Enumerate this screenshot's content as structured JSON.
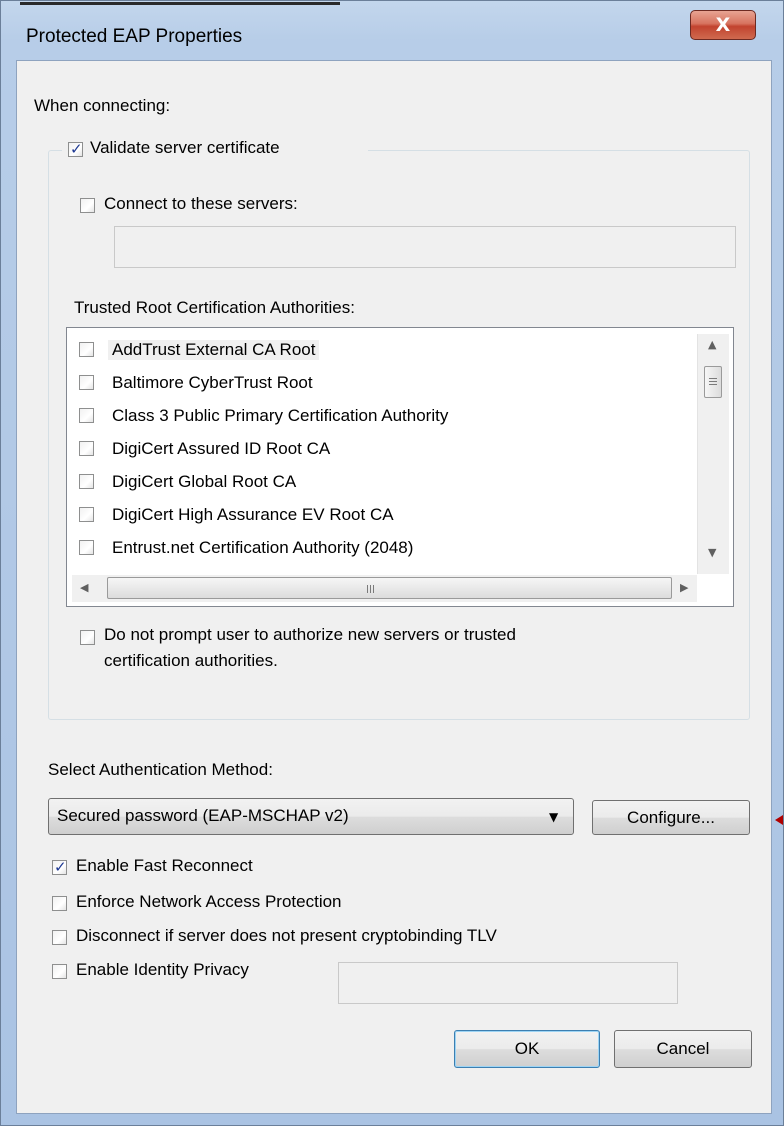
{
  "window": {
    "title": "Protected EAP Properties",
    "close_glyph": "X"
  },
  "connecting": {
    "heading": "When connecting:",
    "validate_label": "Validate server certificate",
    "validate_checked": true,
    "connect_servers_label": "Connect to these servers:",
    "connect_servers_checked": false,
    "servers_value": "",
    "trusted_heading": "Trusted Root Certification Authorities:",
    "ca_list": [
      {
        "label": "AddTrust External CA Root",
        "checked": false
      },
      {
        "label": "Baltimore CyberTrust Root",
        "checked": false
      },
      {
        "label": "Class 3 Public Primary Certification Authority",
        "checked": false
      },
      {
        "label": "DigiCert Assured ID Root CA",
        "checked": false
      },
      {
        "label": "DigiCert Global Root CA",
        "checked": false
      },
      {
        "label": "DigiCert High Assurance EV Root CA",
        "checked": false
      },
      {
        "label": "Entrust.net Certification Authority (2048)",
        "checked": false
      }
    ],
    "do_not_prompt_line1": "Do not prompt user to authorize new servers or trusted",
    "do_not_prompt_line2": "certification authorities.",
    "do_not_prompt_checked": false
  },
  "auth": {
    "heading": "Select Authentication Method:",
    "selected_method": "Secured password (EAP-MSCHAP v2)",
    "configure_label": "Configure..."
  },
  "options": {
    "fast_reconnect_label": "Enable Fast Reconnect",
    "fast_reconnect_checked": true,
    "nap_label": "Enforce Network Access Protection",
    "nap_checked": false,
    "cryptobinding_label": "Disconnect if server does not present cryptobinding TLV",
    "cryptobinding_checked": false,
    "identity_privacy_label": "Enable Identity Privacy",
    "identity_privacy_checked": false,
    "identity_value": ""
  },
  "buttons": {
    "ok_label": "OK",
    "cancel_label": "Cancel"
  },
  "icons": {
    "close": "close-icon",
    "dropdown": "chevron-down-icon",
    "scroll_up": "triangle-up-icon",
    "scroll_down": "triangle-down-icon",
    "scroll_left": "triangle-left-icon",
    "scroll_right": "triangle-right-icon",
    "checkmark": "checkmark-icon"
  },
  "colors": {
    "title_bar": "#b7cde8",
    "dialog_bg": "#f0f0f0",
    "close_button": "#c2432f",
    "check_mark": "#1f3a93",
    "pointer_marker": "#b00000"
  }
}
